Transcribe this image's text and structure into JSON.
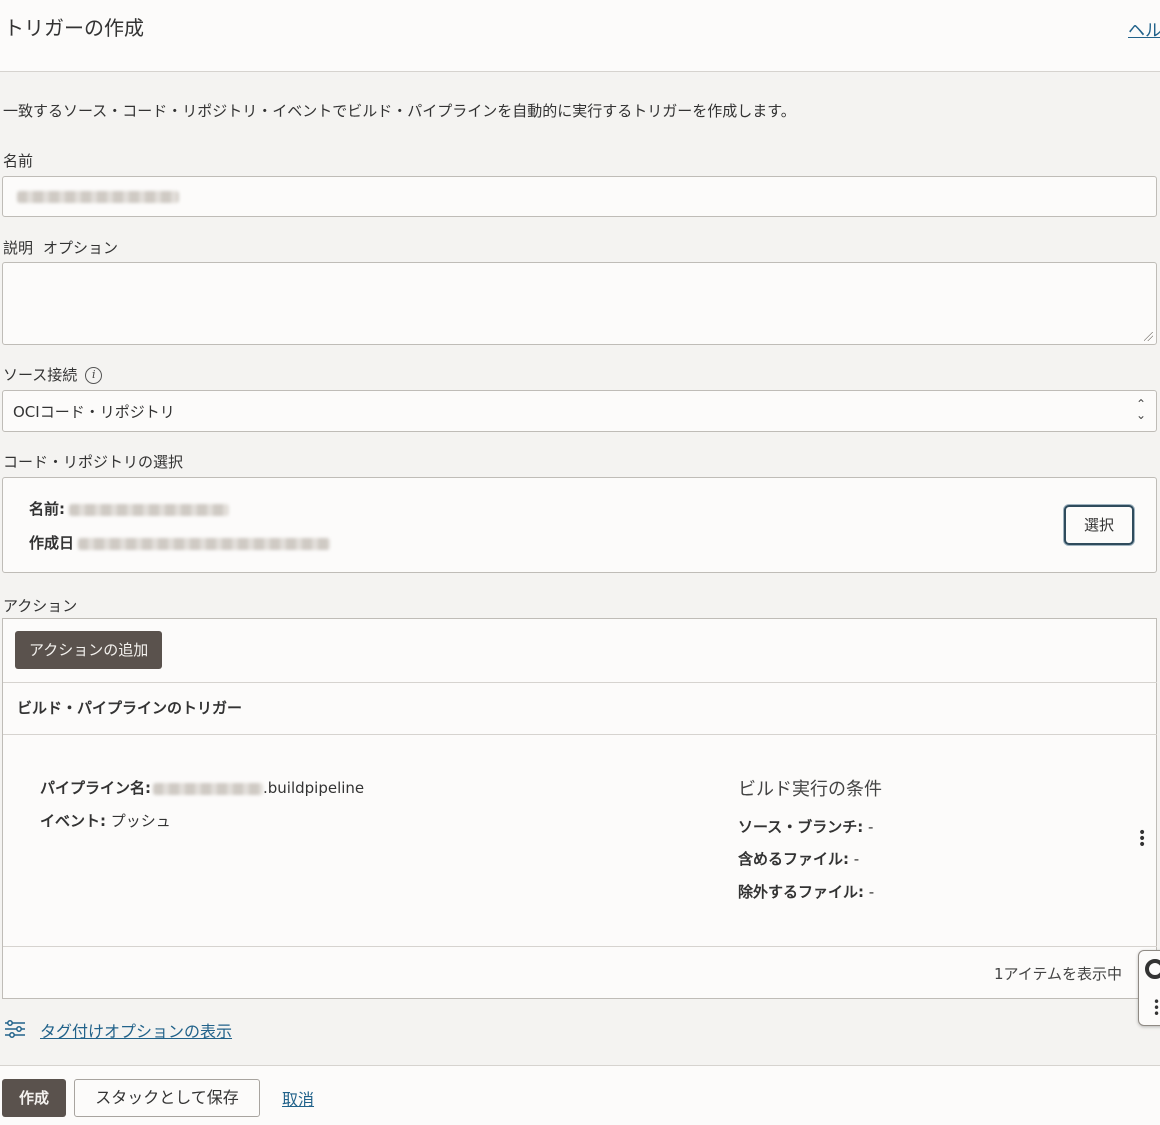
{
  "header": {
    "title": "トリガーの作成",
    "help_link": "ヘルプ"
  },
  "form": {
    "description_text": "一致するソース・コード・リポジトリ・イベントでビルド・パイプラインを自動的に実行するトリガーを作成します。",
    "name_label": "名前",
    "description_label": "説明",
    "description_optional": "オプション",
    "source_connection_label": "ソース接続",
    "source_connection_value": "OCIコード・リポジトリ",
    "repo_select_label": "コード・リポジトリの選択",
    "repo": {
      "name_label": "名前:",
      "created_label": "作成日",
      "select_button": "選択"
    },
    "actions_label": "アクション",
    "add_action_button": "アクションの追加",
    "trigger_card": {
      "title": "ビルド・パイプラインのトリガー",
      "pipeline_label": "パイプライン名:",
      "pipeline_suffix": ".buildpipeline",
      "event_label": "イベント:",
      "event_value": "プッシュ",
      "conditions_title": "ビルド実行の条件",
      "source_branch_label": "ソース・ブランチ:",
      "source_branch_value": "-",
      "include_files_label": "含めるファイル:",
      "include_files_value": "-",
      "exclude_files_label": "除外するファイル:",
      "exclude_files_value": "-"
    },
    "items_count": "1アイテムを表示中",
    "tagging_link": "タグ付けオプションの表示"
  },
  "footer": {
    "create_button": "作成",
    "save_stack_button": "スタックとして保存",
    "cancel_link": "取消"
  },
  "icons": [
    "info-icon",
    "sort-arrows-icon",
    "kebab-menu-icon",
    "tag-options-icon",
    "help-ring-icon"
  ]
}
